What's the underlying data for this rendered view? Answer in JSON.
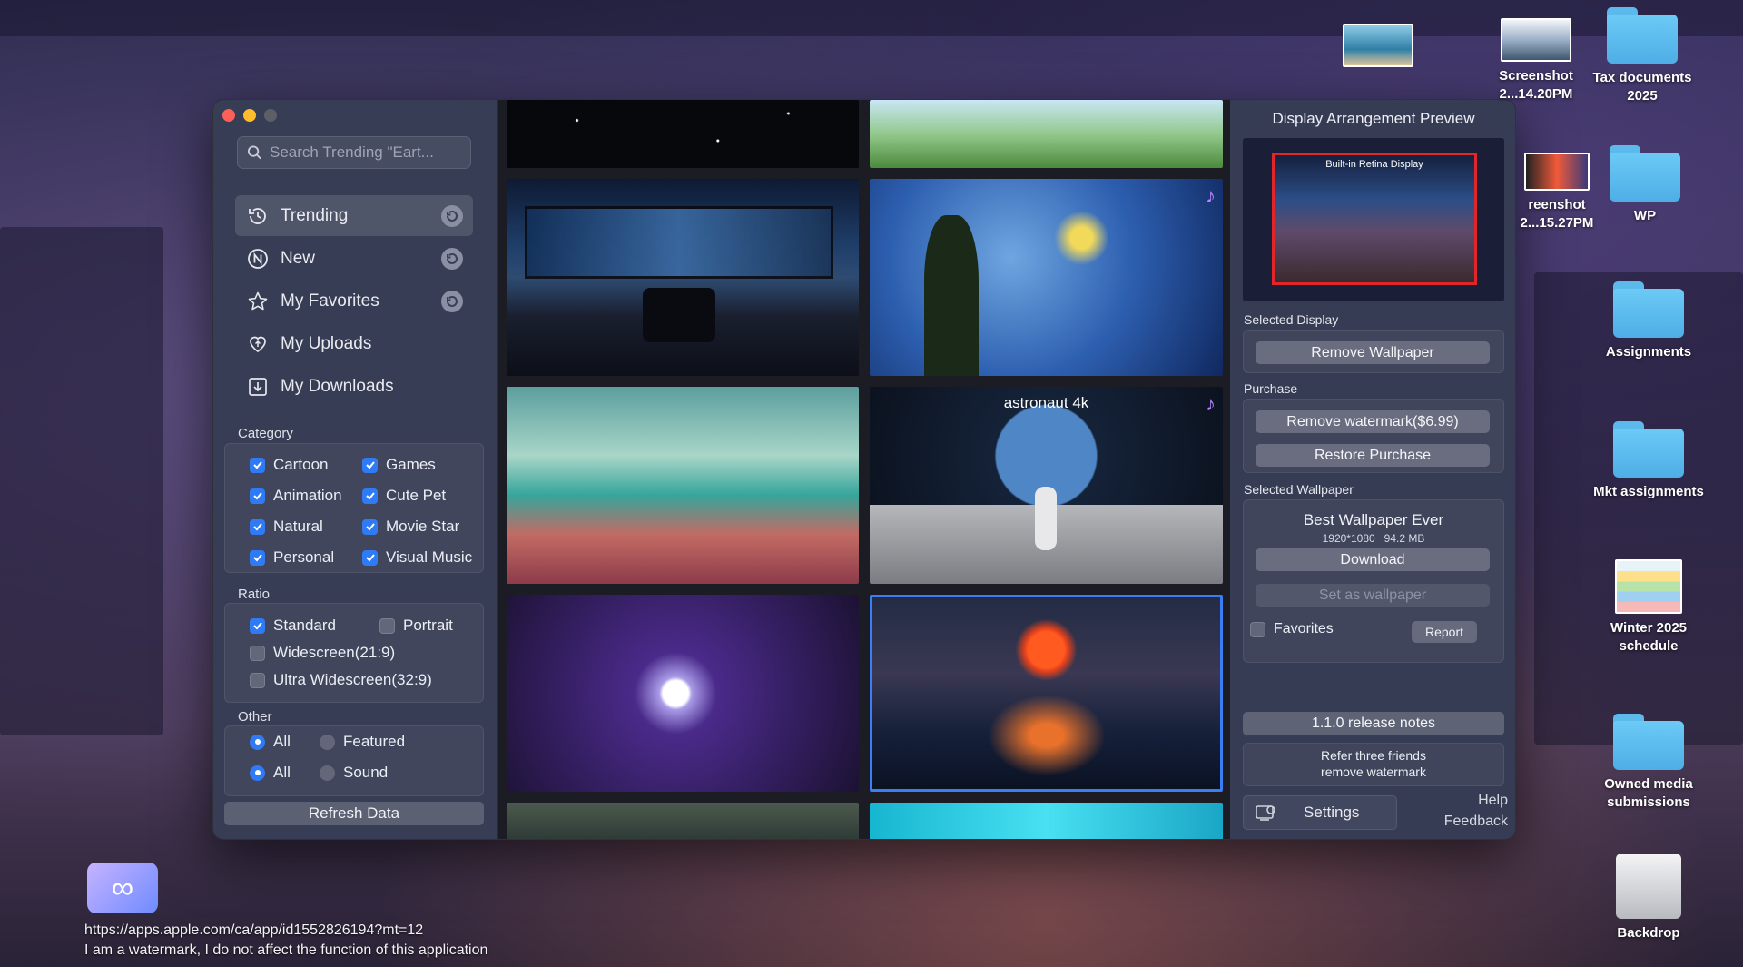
{
  "window": {
    "search_placeholder": "Search Trending \"Eart...",
    "nav": [
      {
        "label": "Trending",
        "icon": "trending-icon"
      },
      {
        "label": "New",
        "icon": "new-icon"
      },
      {
        "label": "My Favorites",
        "icon": "star-icon"
      },
      {
        "label": "My Uploads",
        "icon": "heart-upload-icon"
      },
      {
        "label": "My Downloads",
        "icon": "download-icon"
      }
    ],
    "category": {
      "title": "Category",
      "items": [
        {
          "label": "Cartoon",
          "checked": true
        },
        {
          "label": "Games",
          "checked": true
        },
        {
          "label": "Animation",
          "checked": true
        },
        {
          "label": "Cute Pet",
          "checked": true
        },
        {
          "label": "Natural",
          "checked": true
        },
        {
          "label": "Movie Star",
          "checked": true
        },
        {
          "label": "Personal",
          "checked": true
        },
        {
          "label": "Visual Music",
          "checked": true
        }
      ]
    },
    "ratio": {
      "title": "Ratio",
      "items": [
        {
          "label": "Standard",
          "checked": true
        },
        {
          "label": "Portrait",
          "checked": false
        },
        {
          "label": "Widescreen(21:9)",
          "checked": false
        },
        {
          "label": "Ultra Widescreen(32:9)",
          "checked": false
        }
      ]
    },
    "other": {
      "title": "Other",
      "row1": [
        {
          "label": "All",
          "selected": true
        },
        {
          "label": "Featured",
          "selected": false
        }
      ],
      "row2": [
        {
          "label": "All",
          "selected": true
        },
        {
          "label": "Sound",
          "selected": false
        }
      ]
    },
    "refresh_label": "Refresh Data",
    "grid": {
      "astronaut_title": "astronaut 4k"
    },
    "panel": {
      "title": "Display Arrangement Preview",
      "preview_label": "Built-in Retina Display",
      "selected_display_label": "Selected Display",
      "remove_wallpaper": "Remove Wallpaper",
      "purchase_label": "Purchase",
      "remove_watermark": "Remove watermark($6.99)",
      "restore_purchase": "Restore Purchase",
      "selected_wallpaper_label": "Selected Wallpaper",
      "wallpaper_name": "Best Wallpaper Ever",
      "wallpaper_meta": "1920*1080   94.2 MB",
      "download": "Download",
      "set_as_wallpaper": "Set as wallpaper",
      "favorites": "Favorites",
      "report": "Report",
      "release_notes": "1.1.0 release notes",
      "refer_line1": "Refer three friends",
      "refer_line2": "remove watermark",
      "settings": "Settings",
      "help": "Help",
      "feedback": "Feedback"
    }
  },
  "desktop": {
    "icons": [
      {
        "label": "Screenshot",
        "sub": "2...14.20PM"
      },
      {
        "label": "Tax documents",
        "sub": "2025"
      },
      {
        "label": "reenshot",
        "sub": "2...15.27PM"
      },
      {
        "label": "WP",
        "sub": ""
      },
      {
        "label": "Assignments",
        "sub": ""
      },
      {
        "label": "Mkt assignments",
        "sub": ""
      },
      {
        "label": "Winter 2025",
        "sub": "schedule"
      },
      {
        "label": "Owned media",
        "sub": "submissions"
      },
      {
        "label": "Backdrop",
        "sub": ""
      }
    ]
  },
  "watermark": {
    "url": "https://apps.apple.com/ca/app/id1552826194?mt=12",
    "line2": "I am a watermark, I do not affect the function of this application"
  }
}
